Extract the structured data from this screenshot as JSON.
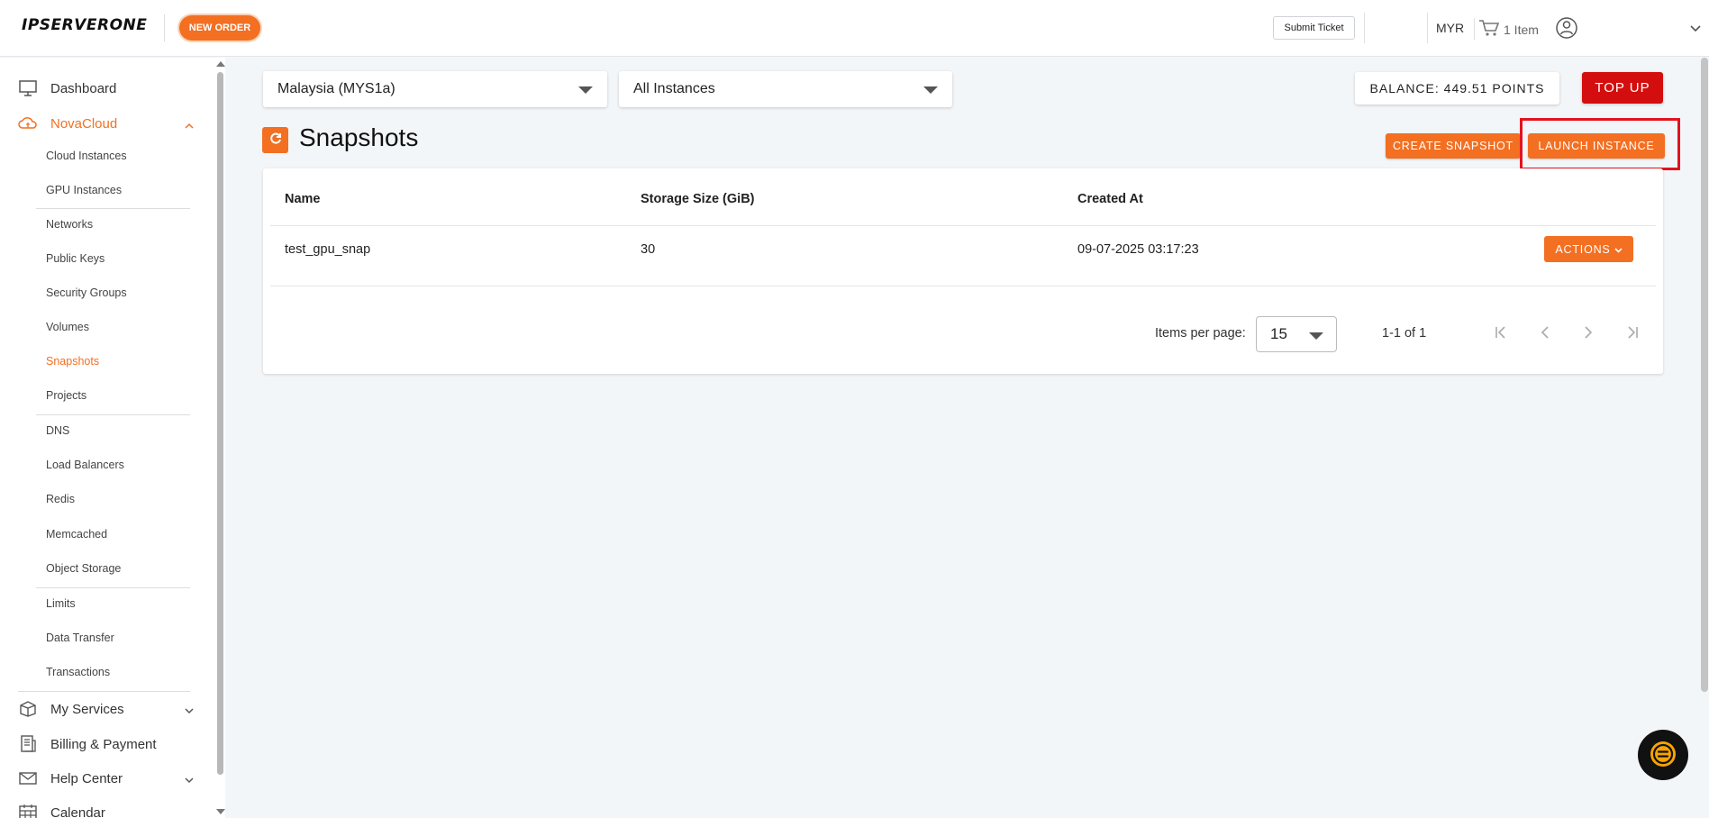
{
  "header": {
    "logo": "IPSERVERONE",
    "new_order": "NEW ORDER",
    "submit_ticket": "Submit Ticket",
    "currency": "MYR",
    "cart": "1 Item"
  },
  "sidebar": {
    "dashboard": "Dashboard",
    "novacloud": "NovaCloud",
    "sub_items": [
      "Cloud Instances",
      "GPU Instances",
      "Networks",
      "Public Keys",
      "Security Groups",
      "Volumes",
      "Snapshots",
      "Projects",
      "DNS",
      "Load Balancers",
      "Redis",
      "Memcached",
      "Object Storage",
      "Limits",
      "Data Transfer",
      "Transactions"
    ],
    "my_services": "My Services",
    "billing": "Billing & Payment",
    "help_center": "Help Center",
    "calendar": "Calendar"
  },
  "filters": {
    "region": "Malaysia (MYS1a)",
    "instance_filter": "All Instances"
  },
  "balance": {
    "label": "BALANCE: 449.51 POINTS",
    "top_up": "TOP UP"
  },
  "page": {
    "title": "Snapshots",
    "create_snapshot": "CREATE SNAPSHOT",
    "launch_instance": "LAUNCH INSTANCE"
  },
  "table": {
    "columns": [
      "Name",
      "Storage Size (GiB)",
      "Created At"
    ],
    "rows": [
      {
        "name": "test_gpu_snap",
        "size": "30",
        "created": "09-07-2025 03:17:23",
        "action": "ACTIONS"
      }
    ]
  },
  "pagination": {
    "items_per_page_label": "Items per page:",
    "items_per_page": "15",
    "range": "1-1 of 1"
  },
  "colors": {
    "accent": "#f36f21",
    "topup": "#d40e0e",
    "highlight": "#e3131f"
  }
}
